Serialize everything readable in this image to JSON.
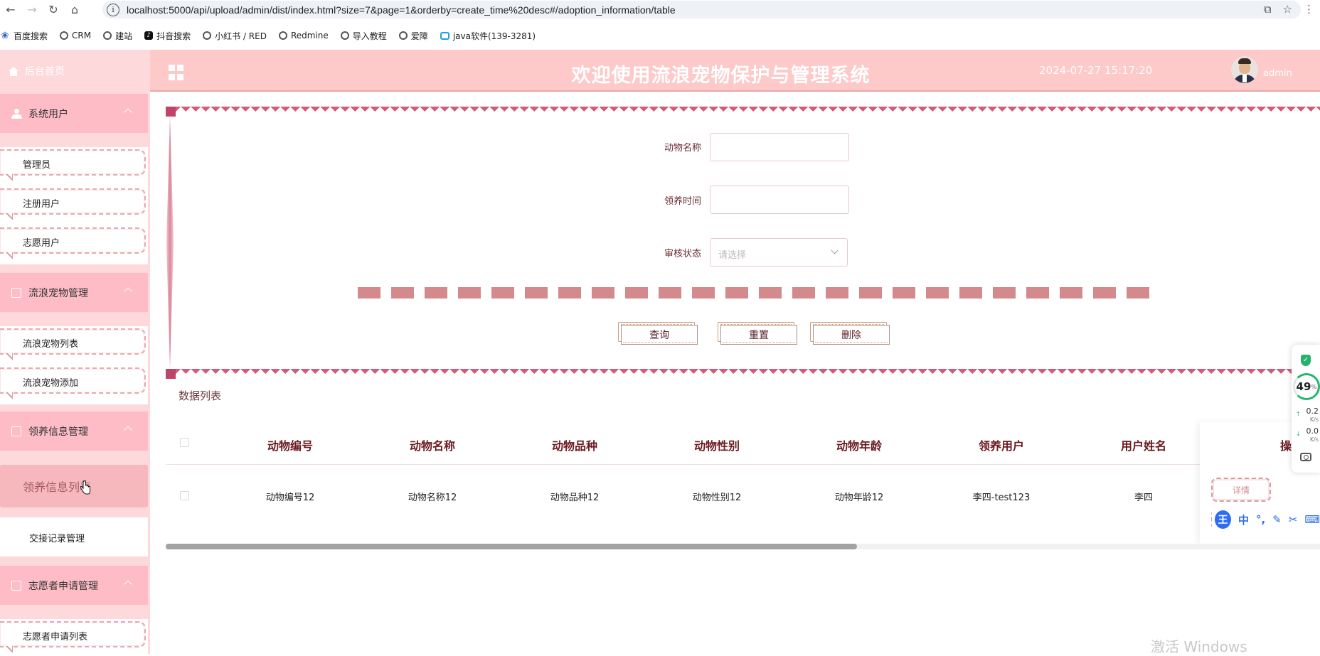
{
  "browser": {
    "url": "localhost:5000/api/upload/admin/dist/index.html?size=7&page=1&orderby=create_time%20desc#/adoption_information/table",
    "bookmarks": [
      "百度搜索",
      "CRM",
      "建站",
      "抖音搜索",
      "小红书 / RED",
      "Redmine",
      "导入教程",
      "爱障",
      "java软件(139-3281)"
    ]
  },
  "sidebar": {
    "home": "后台首页",
    "groups": {
      "system_users": "系统用户",
      "stray_pets": "流浪宠物管理",
      "adoption": "领养信息管理",
      "volunteer": "志愿者申请管理"
    },
    "items": {
      "admin": "管理员",
      "registered_user": "注册用户",
      "volunteer_user": "志愿用户",
      "pet_list": "流浪宠物列表",
      "pet_add": "流浪宠物添加",
      "adoption_list": "领养信息列表",
      "handover": "交接记录管理",
      "volunteer_list": "志愿者申请列表"
    }
  },
  "header": {
    "title": "欢迎使用流浪宠物保护与管理系统",
    "datetime": "2024-07-27 15:17:20",
    "username": "admin"
  },
  "search": {
    "animal_name_label": "动物名称",
    "adopt_time_label": "领养时间",
    "status_label": "审核状态",
    "status_placeholder": "请选择",
    "query_btn": "查询",
    "reset_btn": "重置",
    "delete_btn": "删除"
  },
  "list": {
    "title": "数据列表",
    "columns": [
      "动物编号",
      "动物名称",
      "动物品种",
      "动物性别",
      "动物年龄",
      "领养用户",
      "用户姓名",
      "操作"
    ],
    "rows": [
      [
        "动物编号12",
        "动物名称12",
        "动物品种12",
        "动物性别12",
        "动物年龄12",
        "李四-test123",
        "李四"
      ]
    ],
    "detail_btn": "详情"
  },
  "overlay": {
    "ime_logo": "王",
    "ime_lang": "中",
    "perf_value": "49",
    "perf_unit": "%",
    "net_up": "0.2",
    "net_down": "0.0",
    "net_unit": "K/s",
    "watermark": "激活 Windows"
  }
}
